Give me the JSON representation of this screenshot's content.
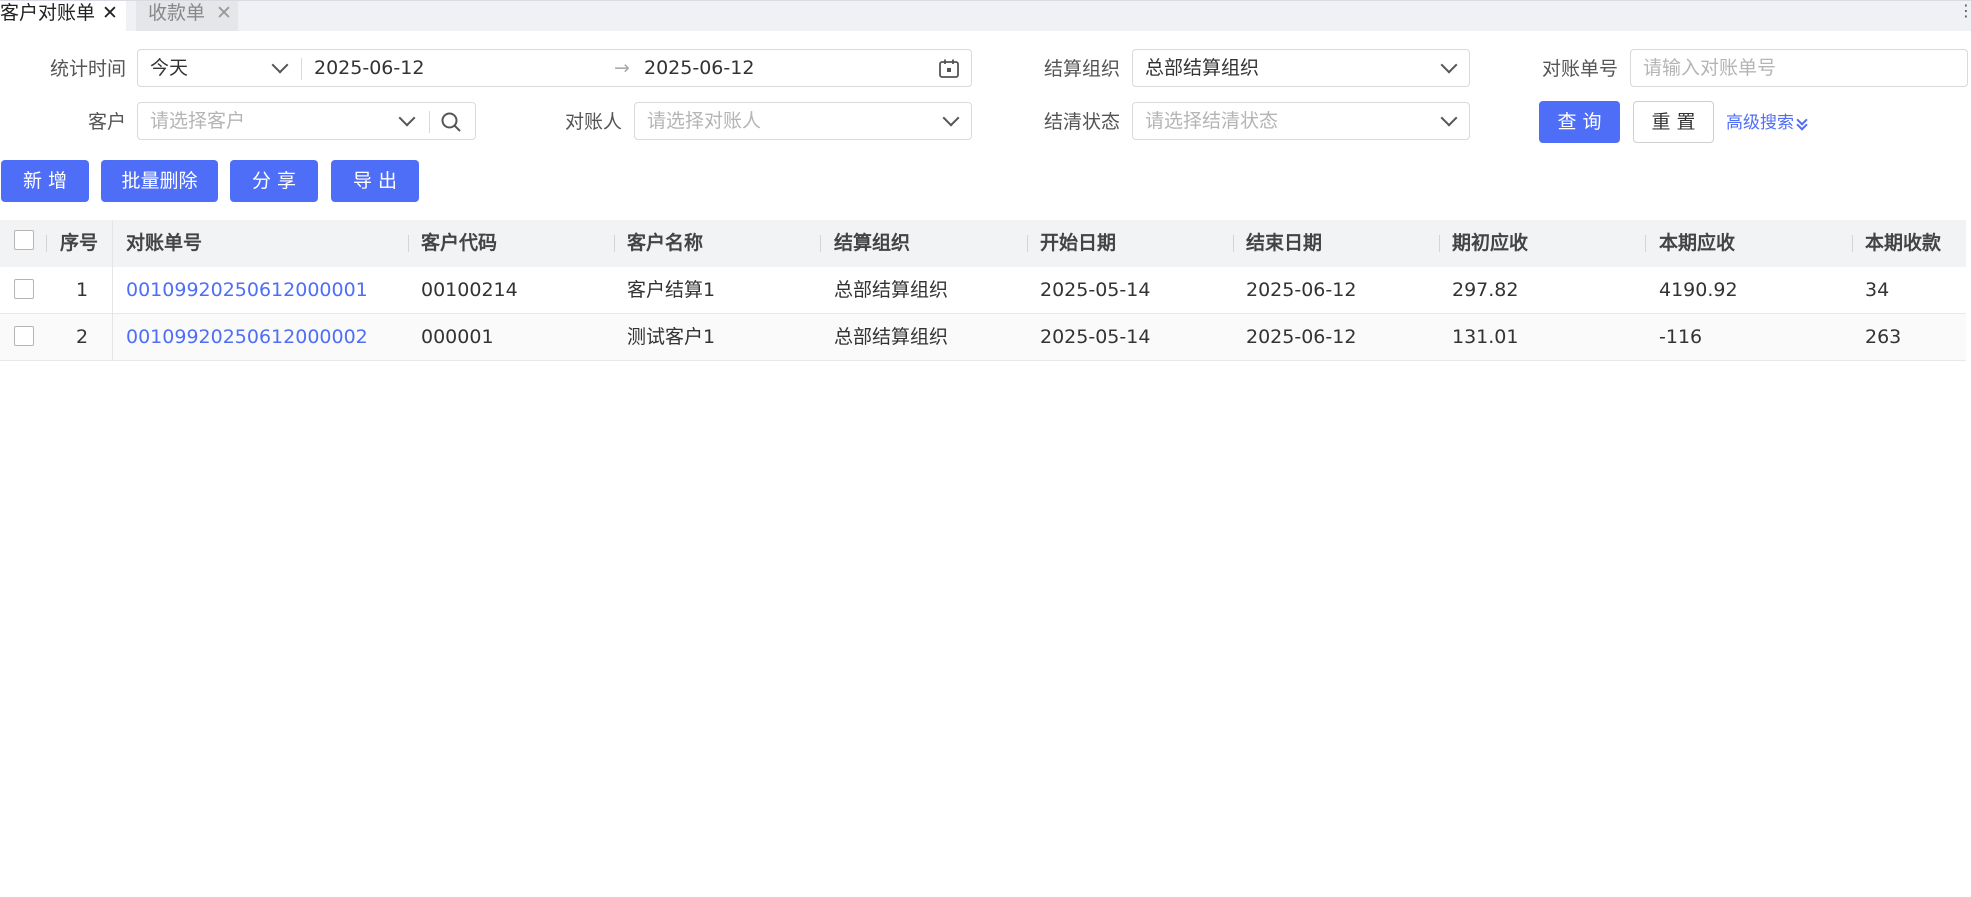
{
  "tabs": [
    {
      "label": "客户对账单",
      "close": "✕"
    },
    {
      "label": "收款单",
      "close": "✕"
    }
  ],
  "filters": {
    "stat_time": {
      "label": "统计时间",
      "preset": "今天",
      "start": "2025-06-12",
      "arrow": "→",
      "end": "2025-06-12"
    },
    "settle_org": {
      "label": "结算组织",
      "value": "总部结算组织"
    },
    "recon_no": {
      "label": "对账单号",
      "placeholder": "请输入对账单号"
    },
    "customer": {
      "label": "客户",
      "placeholder": "请选择客户"
    },
    "reconciler": {
      "label": "对账人",
      "placeholder": "请选择对账人"
    },
    "clear_status": {
      "label": "结清状态",
      "placeholder": "请选择结清状态"
    }
  },
  "actions": {
    "query": "查 询",
    "reset": "重 置",
    "advanced": "高级搜索"
  },
  "toolbar": {
    "add": "新 增",
    "batch_delete": "批量删除",
    "share": "分 享",
    "export": "导 出"
  },
  "table": {
    "headers": [
      "序号",
      "对账单号",
      "客户代码",
      "客户名称",
      "结算组织",
      "开始日期",
      "结束日期",
      "期初应收",
      "本期应收",
      "本期收款"
    ],
    "rows": [
      [
        "1",
        "00109920250612000001",
        "00100214",
        "客户结算1",
        "总部结算组织",
        "2025-05-14",
        "2025-06-12",
        "297.82",
        "4190.92",
        "34"
      ],
      [
        "2",
        "00109920250612000002",
        "000001",
        "测试客户1",
        "总部结算组织",
        "2025-05-14",
        "2025-06-12",
        "131.01",
        "-116",
        "263"
      ]
    ]
  },
  "colors": {
    "primary": "#4f6ef7",
    "link": "#4f6ef7",
    "header_bg": "#f2f3f5"
  }
}
